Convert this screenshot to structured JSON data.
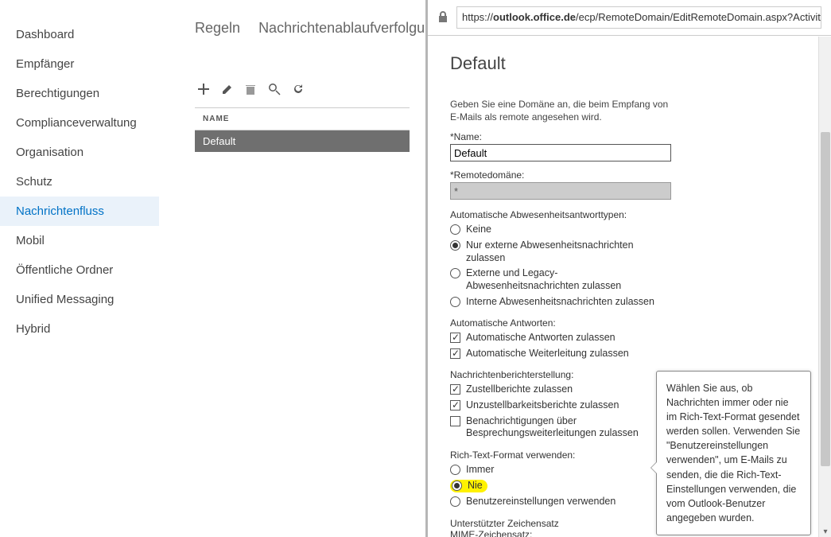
{
  "sidebar": {
    "items": [
      {
        "label": "Dashboard"
      },
      {
        "label": "Empfänger"
      },
      {
        "label": "Berechtigungen"
      },
      {
        "label": "Complianceverwaltung"
      },
      {
        "label": "Organisation"
      },
      {
        "label": "Schutz"
      },
      {
        "label": "Nachrichtenfluss"
      },
      {
        "label": "Mobil"
      },
      {
        "label": "Öffentliche Ordner"
      },
      {
        "label": "Unified Messaging"
      },
      {
        "label": "Hybrid"
      }
    ],
    "active_index": 6
  },
  "tabs": {
    "items": [
      "Regeln",
      "Nachrichtenablaufverfolgung"
    ]
  },
  "list": {
    "header": "NAME",
    "rows": [
      "Default"
    ]
  },
  "panel": {
    "url_prefix": "https://",
    "url_host": "outlook.office.de",
    "url_rest": "/ecp/RemoteDomain/EditRemoteDomain.aspx?Activity",
    "title": "Default",
    "hint_line1": "Geben Sie eine Domäne an, die beim Empfang von",
    "hint_line2": "E-Mails als remote angesehen wird.",
    "name_label": "Name:",
    "name_value": "Default",
    "remote_label": "Remotedomäne:",
    "remote_value": "*",
    "oof_header": "Automatische Abwesenheitsantworttypen:",
    "oof_none": "Keine",
    "oof_external": "Nur externe Abwesenheitsnachrichten zulassen",
    "oof_legacy": "Externe und Legacy-Abwesenheitsnachrichten zulassen",
    "oof_internal": "Interne Abwesenheitsnachrichten zulassen",
    "auto_header": "Automatische Antworten:",
    "auto_replies": "Automatische Antworten zulassen",
    "auto_fwd": "Automatische Weiterleitung zulassen",
    "report_header": "Nachrichtenberichterstellung:",
    "dr": "Zustellberichte zulassen",
    "ndr": "Unzustellbarkeitsberichte zulassen",
    "meeting_fwd": "Benachrichtigungen über Besprechungsweiterleitungen zulassen",
    "rtf_header": "Rich-Text-Format verwenden:",
    "rtf_always": "Immer",
    "rtf_never": "Nie",
    "rtf_user": "Benutzereinstellungen verwenden",
    "charset_header1": "Unterstützter Zeichensatz",
    "charset_header2": "MIME-Zeichensatz:"
  },
  "tooltip": {
    "text": "Wählen Sie aus, ob Nachrichten immer oder nie im Rich-Text-Format gesendet werden sollen. Verwenden Sie \"Benutzereinstellungen verwenden\", um E-Mails zu senden, die die Rich-Text-Einstellungen verwenden, die vom Outlook-Benutzer angegeben wurden."
  }
}
